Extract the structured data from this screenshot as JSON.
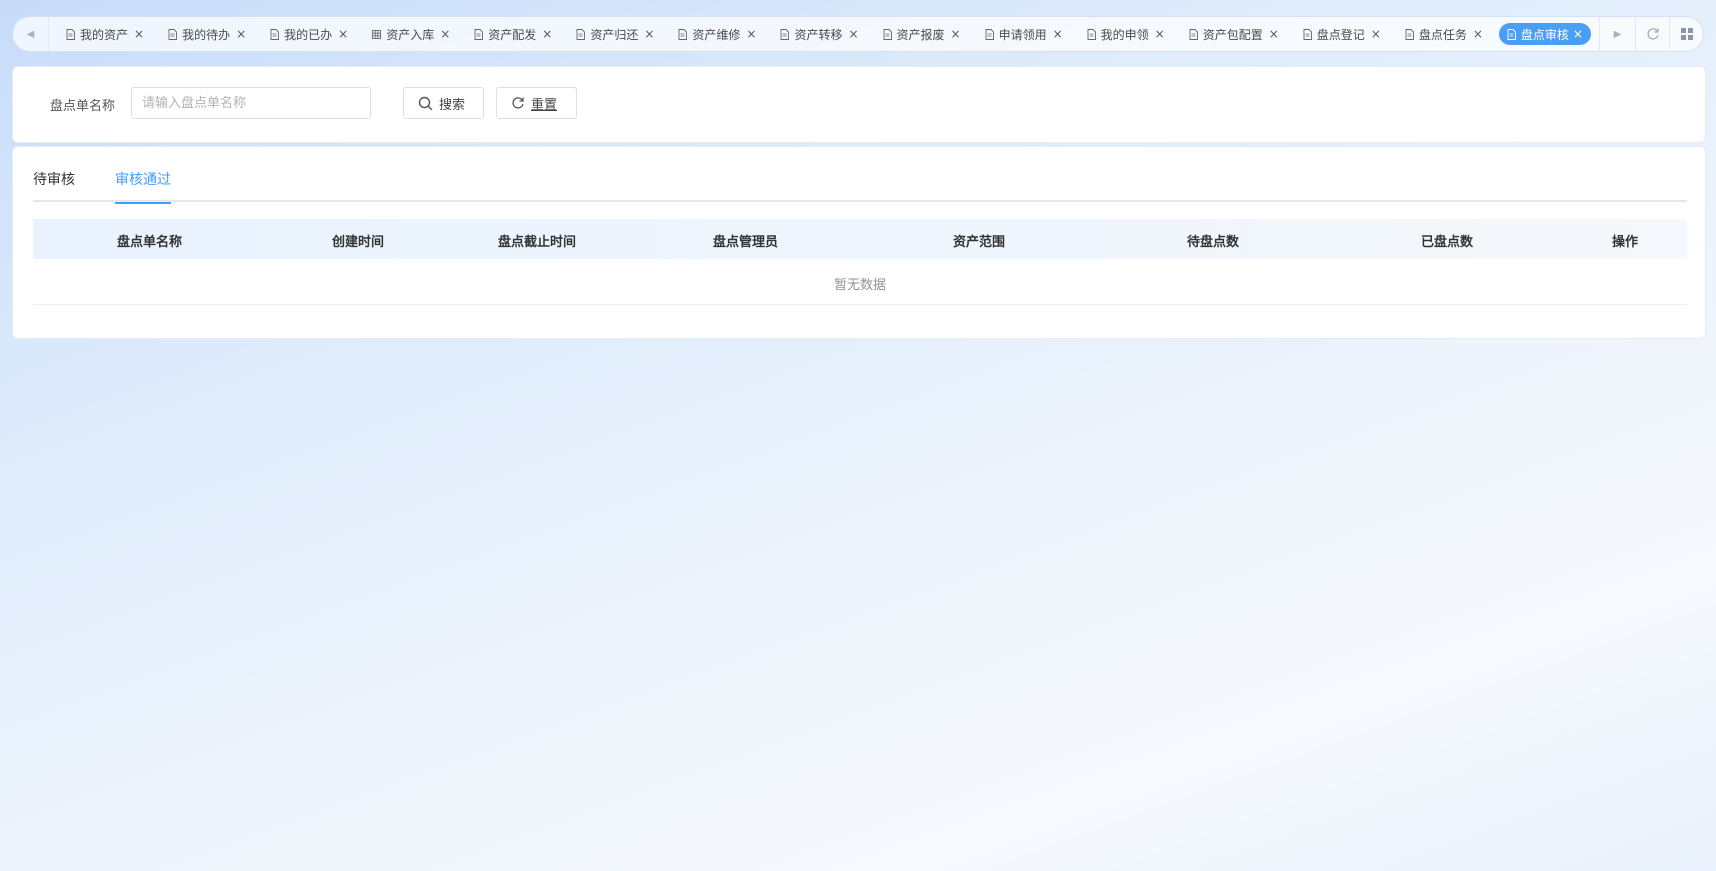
{
  "tabbar": {
    "tabs": [
      {
        "label": "我的资产",
        "icon": "document-icon"
      },
      {
        "label": "我的待办",
        "icon": "document-icon"
      },
      {
        "label": "我的已办",
        "icon": "document-icon"
      },
      {
        "label": "资产入库",
        "icon": "grid-icon"
      },
      {
        "label": "资产配发",
        "icon": "document-icon"
      },
      {
        "label": "资产归还",
        "icon": "document-icon"
      },
      {
        "label": "资产维修",
        "icon": "document-icon"
      },
      {
        "label": "资产转移",
        "icon": "document-icon"
      },
      {
        "label": "资产报废",
        "icon": "document-icon"
      },
      {
        "label": "申请领用",
        "icon": "document-icon"
      },
      {
        "label": "我的申领",
        "icon": "document-icon"
      },
      {
        "label": "资产包配置",
        "icon": "document-icon"
      },
      {
        "label": "盘点登记",
        "icon": "document-icon"
      },
      {
        "label": "盘点任务",
        "icon": "document-icon"
      },
      {
        "label": "盘点审核",
        "icon": "document-icon",
        "active": true
      }
    ],
    "close_glyph": "×"
  },
  "search": {
    "label": "盘点单名称",
    "placeholder": "请输入盘点单名称",
    "search_button": "搜索",
    "reset_button": "重置"
  },
  "page_tabs": [
    "待审核",
    "审核通过"
  ],
  "table": {
    "columns": [
      "盘点单名称",
      "创建时间",
      "盘点截止时间",
      "盘点管理员",
      "资产范围",
      "待盘点数",
      "已盘点数",
      "操作"
    ],
    "empty_text": "暂无数据"
  },
  "colors": {
    "accent": "#409eff",
    "active_tab": "#4a9ff5"
  }
}
